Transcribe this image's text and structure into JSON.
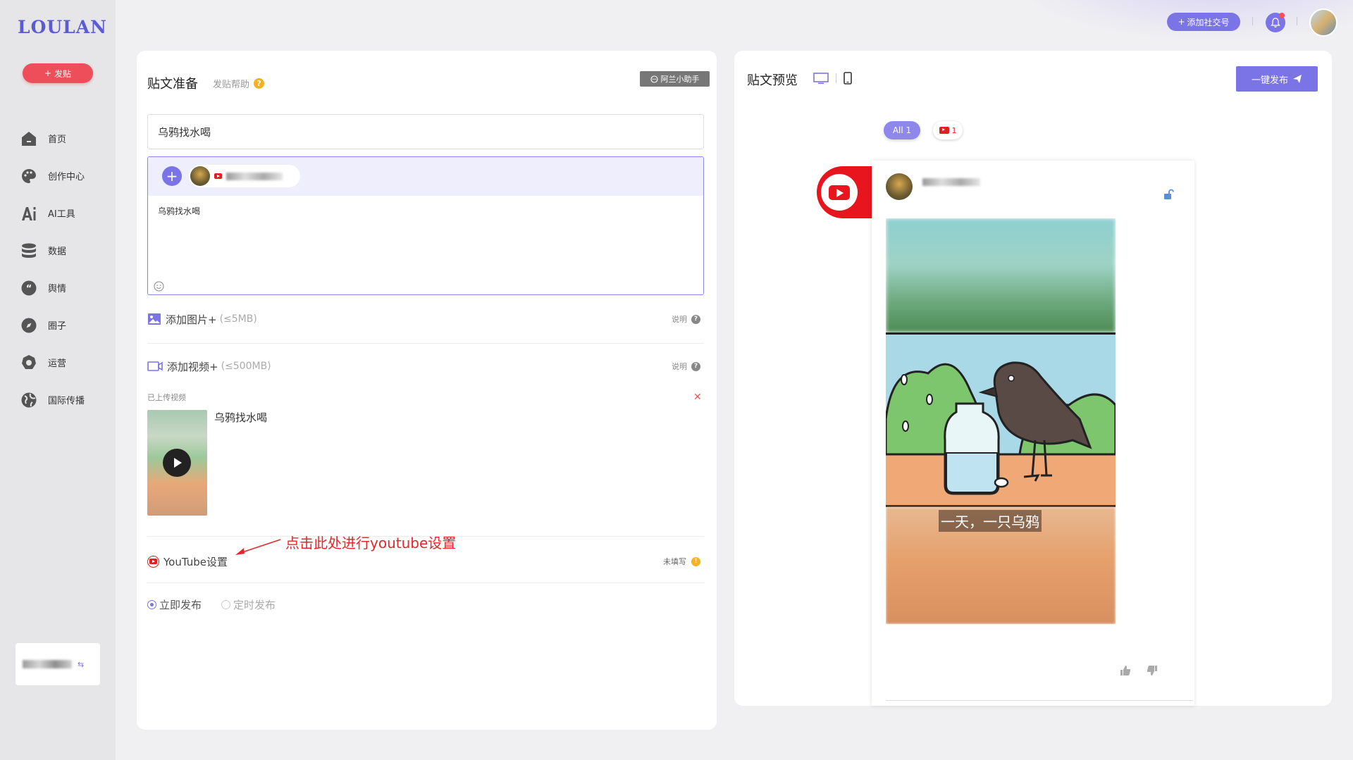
{
  "brand": {
    "logo": "LOULAN",
    "accent": "#7b74e6",
    "danger": "#ee4d5a"
  },
  "sidebar": {
    "post_button": "发贴",
    "items": [
      {
        "label": "首页",
        "icon": "home-icon"
      },
      {
        "label": "创作中心",
        "icon": "palette-icon"
      },
      {
        "label": "AI工具",
        "icon": "ai-icon"
      },
      {
        "label": "数据",
        "icon": "database-icon"
      },
      {
        "label": "舆情",
        "icon": "quote-icon"
      },
      {
        "label": "圈子",
        "icon": "compass-icon"
      },
      {
        "label": "运营",
        "icon": "gear-icon"
      },
      {
        "label": "国际传播",
        "icon": "globe-icon"
      }
    ]
  },
  "topbar": {
    "add_social": "添加社交号"
  },
  "composer": {
    "title": "贴文准备",
    "help": "发贴帮助",
    "assistant": "阿兰小助手",
    "title_value": "乌鸦找水喝",
    "body_value": "乌鸦找水喝",
    "add_image": "添加图片+",
    "image_limit": "(≤5MB)",
    "add_video": "添加视频+",
    "video_limit": "(≤500MB)",
    "spec_label": "说明",
    "uploaded_label": "已上传视频",
    "video_name": "乌鸦找水喝",
    "youtube_setting": "YouTube设置",
    "unfilled": "未填写",
    "annotation": "点击此处进行youtube设置",
    "publish_now": "立即发布",
    "publish_scheduled": "定时发布"
  },
  "preview": {
    "title": "贴文预览",
    "publish_button": "一键发布",
    "filter_all": "All 1",
    "filter_youtube_count": "1",
    "subtitle": "一天，一只乌鸦"
  }
}
